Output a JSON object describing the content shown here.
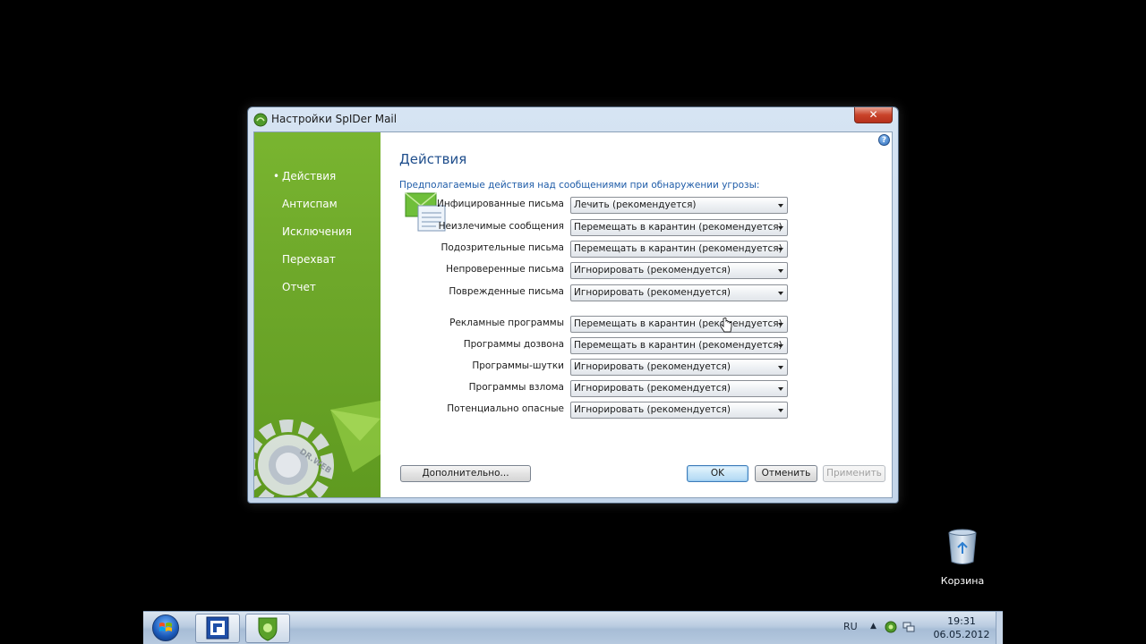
{
  "window": {
    "title": "Настройки SpIDer Mail",
    "close_label": "✕"
  },
  "sidebar": {
    "items": [
      {
        "label": "Действия",
        "active": true
      },
      {
        "label": "Антиспам",
        "active": false
      },
      {
        "label": "Исключения",
        "active": false
      },
      {
        "label": "Перехват",
        "active": false
      },
      {
        "label": "Отчет",
        "active": false
      }
    ],
    "logo_text": "DR.WEB"
  },
  "main": {
    "heading": "Действия",
    "subheading": "Предполагаемые действия над сообщениями при обнаружении угрозы:",
    "help_label": "?",
    "rows": [
      {
        "label": "Инфицированные письма",
        "value": "Лечить (рекомендуется)"
      },
      {
        "label": "Неизлечимые сообщения",
        "value": "Перемещать в карантин (рекомендуется)"
      },
      {
        "label": "Подозрительные письма",
        "value": "Перемещать в карантин (рекомендуется)"
      },
      {
        "label": "Непроверенные письма",
        "value": "Игнорировать (рекомендуется)"
      },
      {
        "label": "Поврежденные письма",
        "value": "Игнорировать (рекомендуется)"
      },
      {
        "label": "Рекламные программы",
        "value": "Перемещать в карантин (рекомендуется)"
      },
      {
        "label": "Программы дозвона",
        "value": "Перемещать в карантин (рекомендуется)"
      },
      {
        "label": "Программы-шутки",
        "value": "Игнорировать (рекомендуется)"
      },
      {
        "label": "Программы взлома",
        "value": "Игнорировать (рекомендуется)"
      },
      {
        "label": "Потенциально опасные",
        "value": "Игнорировать (рекомендуется)"
      }
    ]
  },
  "buttons": {
    "advanced": "Дополнительно...",
    "ok": "OK",
    "cancel": "Отменить",
    "apply": "Применить"
  },
  "desktop": {
    "recycle_bin": "Корзина"
  },
  "taskbar": {
    "language": "RU",
    "time": "19:31",
    "date": "06.05.2012"
  }
}
